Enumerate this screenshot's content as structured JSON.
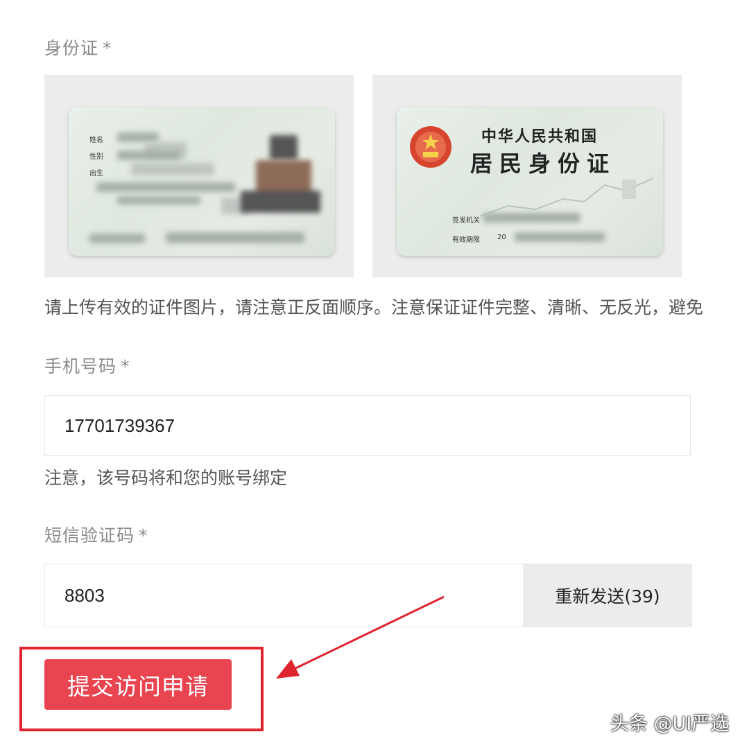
{
  "id_section": {
    "label": "身份证",
    "required_mark": "*",
    "back_card": {
      "title_line1": "中华人民共和国",
      "title_line2": "居民身份证",
      "issuer_label": "签发机关",
      "validity_label": "有效期限",
      "validity_prefix": "20"
    },
    "hint": "请上传有效的证件图片，请注意正反面顺序。注意保证证件完整、清晰、无反光，避免"
  },
  "phone_section": {
    "label": "手机号码",
    "required_mark": "*",
    "value": "17701739367",
    "note": "注意，该号码将和您的账号绑定"
  },
  "sms_section": {
    "label": "短信验证码",
    "required_mark": "*",
    "value": "8803",
    "resend_label": "重新发送(39)"
  },
  "submit_label": "提交访问申请",
  "watermark": "头条 @UI严选",
  "colors": {
    "primary": "#e94550",
    "annotation": "#e0242f",
    "label": "#8a8a8a"
  },
  "icons": [
    "national-emblem-icon",
    "annotation-arrow-icon"
  ]
}
